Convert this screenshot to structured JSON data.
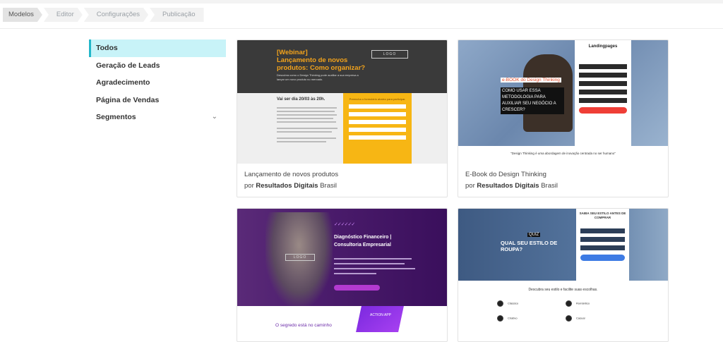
{
  "breadcrumb": [
    "Modelos",
    "Editor",
    "Configurações",
    "Publicação"
  ],
  "sidebar": {
    "items": [
      {
        "label": "Todos",
        "active": true
      },
      {
        "label": "Geração de Leads"
      },
      {
        "label": "Agradecimento"
      },
      {
        "label": "Página de Vendas"
      },
      {
        "label": "Segmentos",
        "expandable": true
      }
    ]
  },
  "cards": [
    {
      "title": "Lançamento de novos produtos",
      "by": "por",
      "author_bold": "Resultados Digitais",
      "author_rest": "Brasil",
      "thumb": {
        "heading": "[Webinar]\nLançamento de novos\nprodutos: Como organizar?",
        "sub": "Descubra como o Design Thinking pode auxiliar a sua empresa a lançar um novo produto no mercado.",
        "logo": "LOGO",
        "date": "Vai ser dia 20/03 às 20h.",
        "form_title": "Preencha o formulário abaixo para participar."
      }
    },
    {
      "title": "E-Book do Design Thinking",
      "by": "por",
      "author_bold": "Resultados Digitais",
      "author_rest": "Brasil",
      "thumb": {
        "brand": "Landingpages",
        "ebook": "e-BOOK do Design Thinking",
        "question": "COMO USAR ESSA METODOLOGIA PARA AUXILIAR SEU NEGÓCIO A CRESCER?",
        "quote": "\"Design Thinking é uma abordagem de inovação centrada no ser humano\""
      }
    },
    {
      "thumb": {
        "checks": "✓✓✓✓✓✓",
        "title": "Diagnóstico Financeiro |\nConsultoria Empresarial",
        "logo": "LOGO",
        "app": "ACTION APP",
        "tagline": "O segredo está no caminho"
      }
    },
    {
      "thumb": {
        "panel_title": "SAIBA SEU ESTILO ANTES DE COMPRAR",
        "question": "QUAL SEU ESTILO DE ROUPA?",
        "question_prefix": "QUIZ",
        "desc": "Descubra seu estilo e facilite suas escolhas.",
        "options": [
          "Clássico",
          "Romântico",
          "Criativo",
          "Casual"
        ]
      }
    }
  ],
  "colors": {
    "accent": "#23b7c9",
    "active_bg": "#c8f3f8",
    "webinar_orange": "#f3a31b",
    "form_yellow": "#f7b614",
    "purple": "#4b1c6c"
  }
}
